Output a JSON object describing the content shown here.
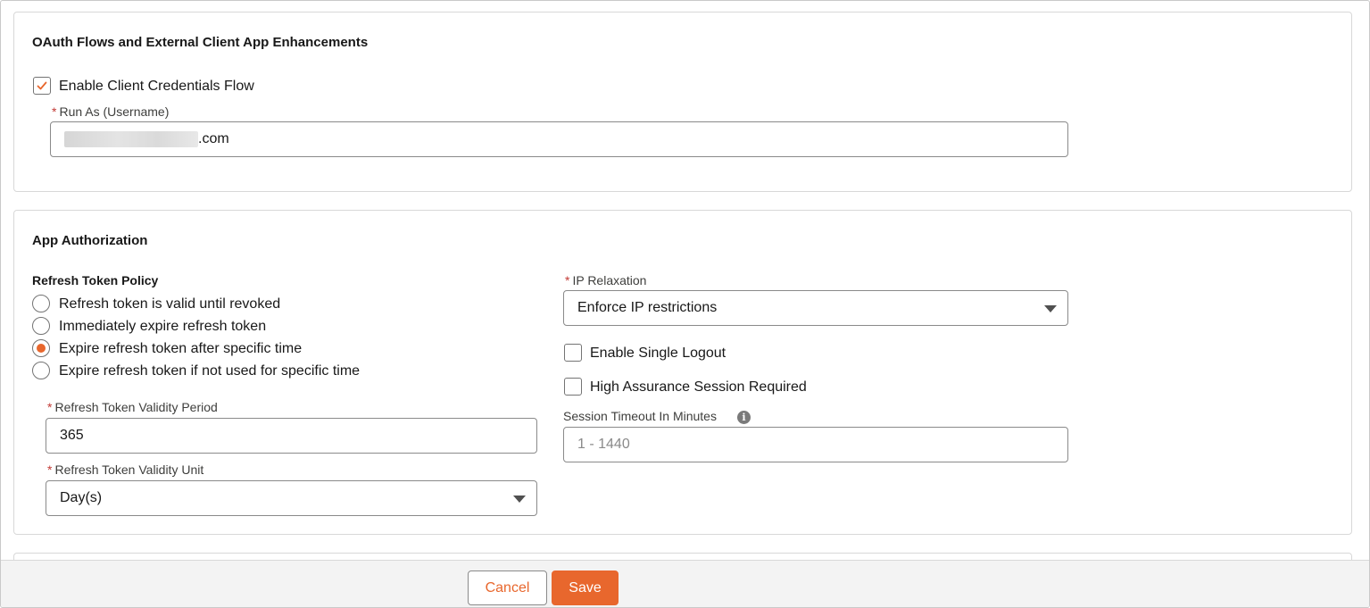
{
  "oauth_section": {
    "title": "OAuth Flows and External Client App Enhancements",
    "client_credentials_label": "Enable Client Credentials Flow",
    "client_credentials_checked": true,
    "run_as_required": "*",
    "run_as_label": "Run As (Username)",
    "run_as_value_suffix": ".com"
  },
  "app_auth_section": {
    "title": "App Authorization",
    "refresh_policy_label": "Refresh Token Policy",
    "refresh_options": [
      {
        "label": "Refresh token is valid until revoked",
        "selected": false
      },
      {
        "label": "Immediately expire refresh token",
        "selected": false
      },
      {
        "label": "Expire refresh token after specific time",
        "selected": true
      },
      {
        "label": "Expire refresh token if not used for specific time",
        "selected": false
      }
    ],
    "validity_period_required": "*",
    "validity_period_label": "Refresh Token Validity Period",
    "validity_period_value": "365",
    "validity_unit_required": "*",
    "validity_unit_label": "Refresh Token Validity Unit",
    "validity_unit_value": "Day(s)",
    "ip_relaxation_required": "*",
    "ip_relaxation_label": "IP Relaxation",
    "ip_relaxation_value": "Enforce IP restrictions",
    "single_logout_label": "Enable Single Logout",
    "single_logout_checked": false,
    "high_assurance_label": "High Assurance Session Required",
    "high_assurance_checked": false,
    "session_timeout_label": "Session Timeout In Minutes",
    "session_timeout_info_glyph": "i",
    "session_timeout_placeholder": "1 - 1440"
  },
  "footer": {
    "cancel_label": "Cancel",
    "save_label": "Save"
  },
  "colors": {
    "accent": "#e8672d",
    "required": "#c23934",
    "border": "#8a8a8a"
  }
}
